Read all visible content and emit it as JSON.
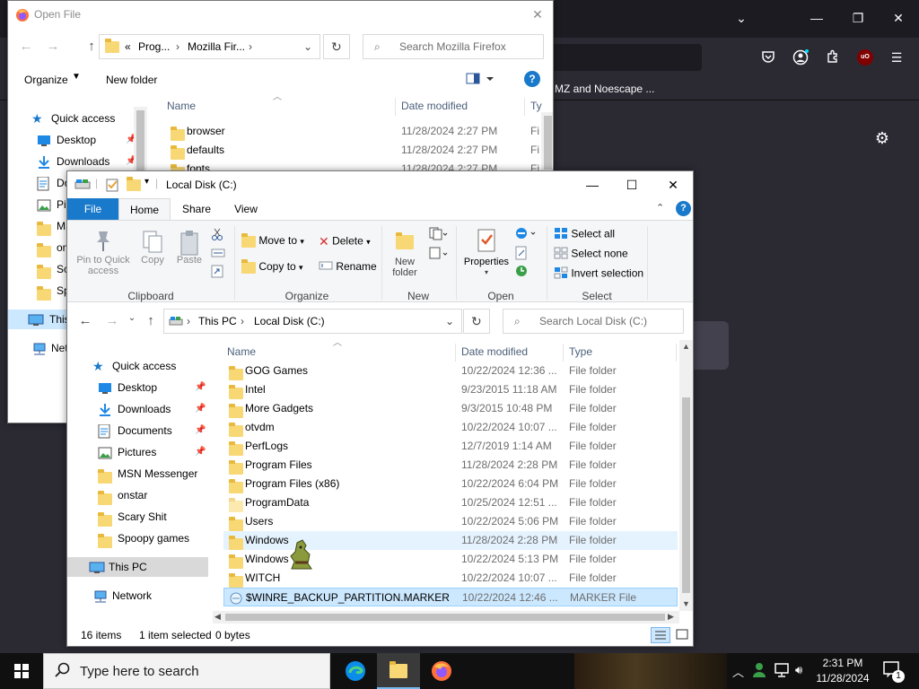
{
  "firefox": {
    "bookmark_text": "MZ and Noescape ...",
    "ublock_label": "uO"
  },
  "open_file": {
    "title": "Open File",
    "breadcrumb": [
      "«",
      "Prog...",
      "Mozilla Fir..."
    ],
    "search_placeholder": "Search Mozilla Firefox",
    "organize_label": "Organize",
    "new_folder_label": "New folder",
    "columns": {
      "name": "Name",
      "date": "Date modified",
      "type": "Ty"
    },
    "nav": [
      {
        "label": "Quick access",
        "icon": "star-icon"
      },
      {
        "label": "Desktop",
        "icon": "desktop-icon"
      },
      {
        "label": "Downloads",
        "icon": "download-icon"
      },
      {
        "label": "Do",
        "icon": "document-icon"
      },
      {
        "label": "Pic",
        "icon": "picture-icon"
      },
      {
        "label": "MS",
        "icon": "folder-icon"
      },
      {
        "label": "on",
        "icon": "folder-icon"
      },
      {
        "label": "Sc",
        "icon": "folder-icon"
      },
      {
        "label": "Sp",
        "icon": "folder-icon"
      },
      {
        "label": "This",
        "icon": "pc-icon"
      },
      {
        "label": "Netw",
        "icon": "network-icon"
      }
    ],
    "rows": [
      {
        "name": "browser",
        "date": "11/28/2024 2:27 PM",
        "type": "Fi"
      },
      {
        "name": "defaults",
        "date": "11/28/2024 2:27 PM",
        "type": "Fi"
      },
      {
        "name": "fonts",
        "date": "11/28/2024 2:27 PM",
        "type": "Fi"
      }
    ]
  },
  "explorer": {
    "title": "Local Disk (C:)",
    "tabs": {
      "file": "File",
      "home": "Home",
      "share": "Share",
      "view": "View"
    },
    "ribbon": {
      "clipboard": {
        "label": "Clipboard",
        "pin": "Pin to Quick access",
        "copy": "Copy",
        "paste": "Paste"
      },
      "organize": {
        "label": "Organize",
        "move_to": "Move to",
        "copy_to": "Copy to",
        "delete": "Delete",
        "rename": "Rename"
      },
      "new": {
        "label": "New",
        "new_folder": "New folder"
      },
      "open": {
        "label": "Open",
        "properties": "Properties"
      },
      "select": {
        "label": "Select",
        "select_all": "Select all",
        "select_none": "Select none",
        "invert": "Invert selection"
      }
    },
    "breadcrumb": [
      "This PC",
      "Local Disk (C:)"
    ],
    "search_placeholder": "Search Local Disk (C:)",
    "columns": {
      "name": "Name",
      "date": "Date modified",
      "type": "Type"
    },
    "nav": [
      {
        "label": "Quick access",
        "icon": "star-icon",
        "pinned": false
      },
      {
        "label": "Desktop",
        "icon": "desktop-icon",
        "pinned": true
      },
      {
        "label": "Downloads",
        "icon": "download-icon",
        "pinned": true
      },
      {
        "label": "Documents",
        "icon": "document-icon",
        "pinned": true
      },
      {
        "label": "Pictures",
        "icon": "picture-icon",
        "pinned": true
      },
      {
        "label": "MSN Messenger",
        "icon": "folder-icon",
        "pinned": false
      },
      {
        "label": "onstar",
        "icon": "folder-icon",
        "pinned": false
      },
      {
        "label": "Scary Shit",
        "icon": "folder-icon",
        "pinned": false
      },
      {
        "label": "Spoopy games",
        "icon": "folder-icon",
        "pinned": false
      },
      {
        "label": "This PC",
        "icon": "pc-icon",
        "pinned": false
      },
      {
        "label": "Network",
        "icon": "network-icon",
        "pinned": false
      }
    ],
    "rows": [
      {
        "name": "GOG Games",
        "date": "10/22/2024 12:36 ...",
        "type": "File folder"
      },
      {
        "name": "Intel",
        "date": "9/23/2015 11:18 AM",
        "type": "File folder"
      },
      {
        "name": "More Gadgets",
        "date": "9/3/2015 10:48 PM",
        "type": "File folder"
      },
      {
        "name": "otvdm",
        "date": "10/22/2024 10:07 ...",
        "type": "File folder"
      },
      {
        "name": "PerfLogs",
        "date": "12/7/2019 1:14 AM",
        "type": "File folder"
      },
      {
        "name": "Program Files",
        "date": "11/28/2024 2:28 PM",
        "type": "File folder"
      },
      {
        "name": "Program Files (x86)",
        "date": "10/22/2024 6:04 PM",
        "type": "File folder"
      },
      {
        "name": "ProgramData",
        "date": "10/25/2024 12:51 ...",
        "type": "File folder"
      },
      {
        "name": "Users",
        "date": "10/22/2024 5:06 PM",
        "type": "File folder"
      },
      {
        "name": "Windows",
        "date": "11/28/2024 2:28 PM",
        "type": "File folder"
      },
      {
        "name": "Windows",
        "date": "10/22/2024 5:13 PM",
        "type": "File folder"
      },
      {
        "name": "WITCH",
        "date": "10/22/2024 10:07 ...",
        "type": "File folder"
      },
      {
        "name": "$WINRE_BACKUP_PARTITION.MARKER",
        "date": "10/22/2024 12:46 ...",
        "type": "MARKER File"
      }
    ],
    "status": {
      "count": "16 items",
      "selected": "1 item selected",
      "size": "0 bytes"
    }
  },
  "taskbar": {
    "search_placeholder": "Type here to search",
    "time": "2:31 PM",
    "date": "11/28/2024",
    "notification_count": "1"
  }
}
